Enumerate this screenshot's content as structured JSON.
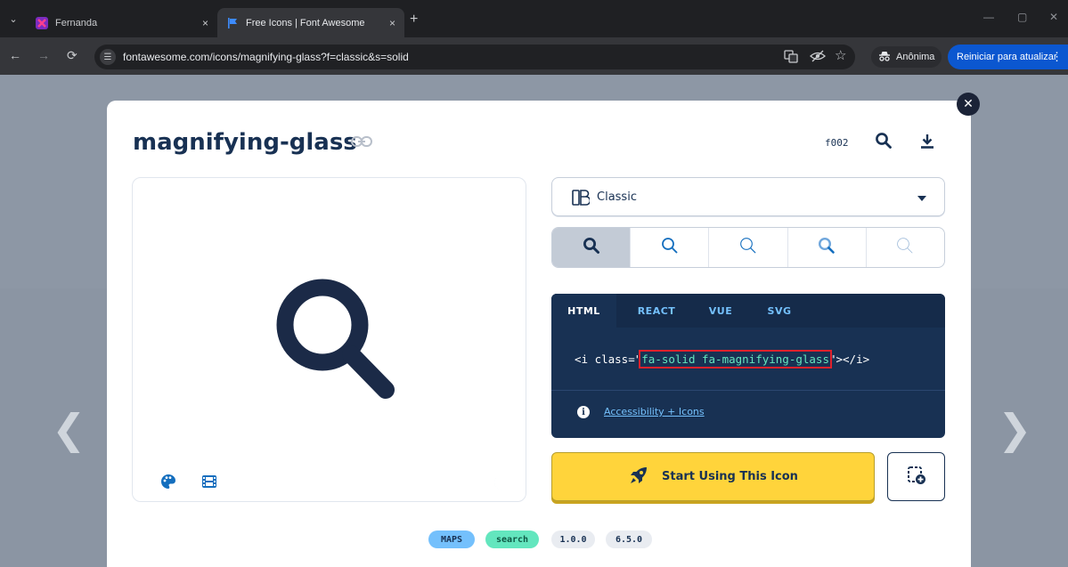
{
  "browser": {
    "tabs": [
      {
        "title": "Fernanda",
        "active": false
      },
      {
        "title": "Free Icons | Font Awesome",
        "active": true
      }
    ],
    "new_tab": "+",
    "tab_close": "×",
    "url": "fontawesome.com/icons/magnifying-glass?f=classic&s=solid",
    "incognito_label": "Anônima",
    "update_label": "Reiniciar para atualizar",
    "colors": {
      "frame": "#1f2023",
      "toolbar": "#35363a",
      "update": "#0b57d0"
    }
  },
  "modal": {
    "title": "magnifying-glass",
    "unicode": "f002",
    "style_select": {
      "value": "Classic"
    },
    "variants": [
      "solid",
      "regular",
      "light",
      "duotone",
      "thin"
    ],
    "code": {
      "tabs": [
        "HTML",
        "REACT",
        "VUE",
        "SVG"
      ],
      "active_tab": "HTML",
      "prefix": "<i class=\"",
      "classes": "fa-solid fa-magnifying-glass",
      "suffix": "\"></i>",
      "accessibility_link": "Accessibility + Icons"
    },
    "start_button": "Start Using This Icon",
    "tags": [
      "MAPS",
      "search",
      "1.0.0",
      "6.5.0"
    ],
    "colors": {
      "navy": "#183153",
      "yellow": "#ffd43b",
      "accent_blue": "#146ebe",
      "code_green": "#63e6be",
      "highlight_red": "#e0212c"
    }
  }
}
